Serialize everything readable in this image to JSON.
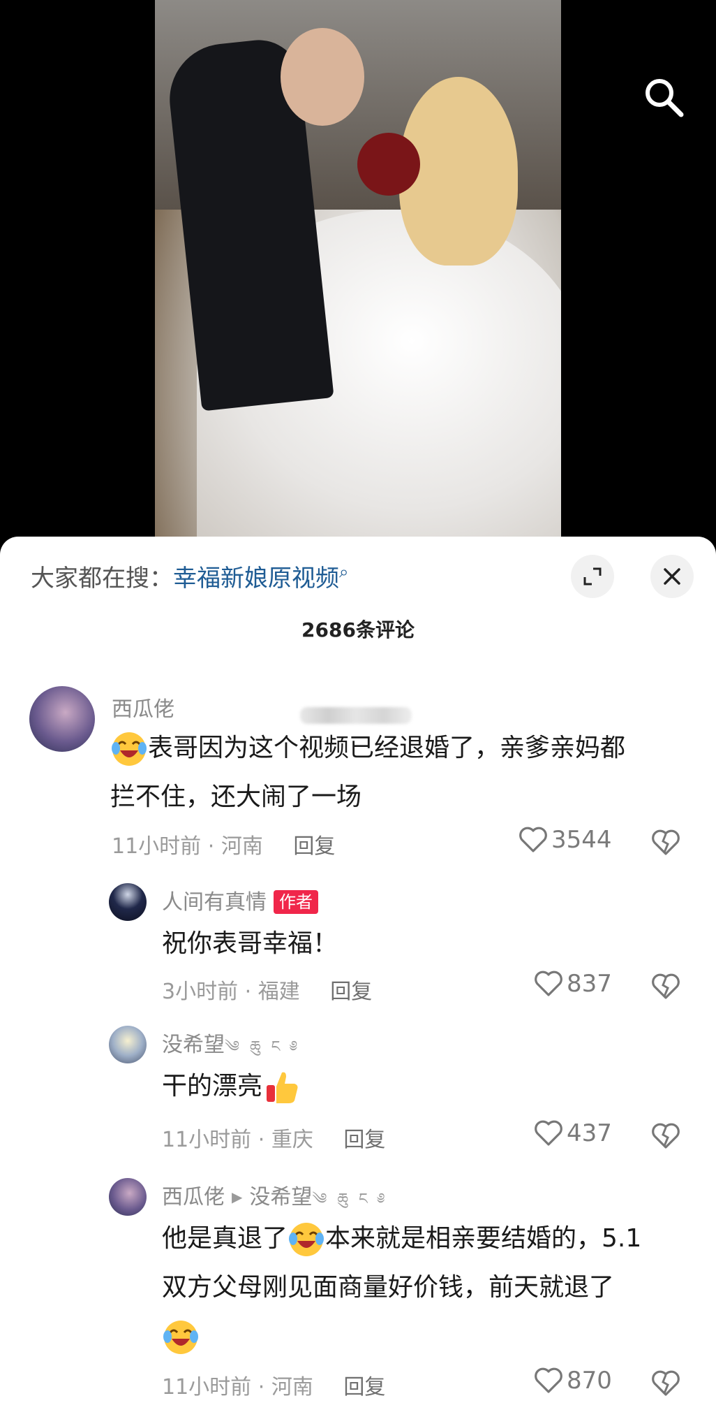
{
  "sheet": {
    "search_prefix": "大家都在搜：",
    "search_keyword": "幸福新娘原视频",
    "comment_count": "2686条评论"
  },
  "comments": [
    {
      "username": "西瓜佬",
      "text_line1": "表哥因为这个视频已经退婚了，亲爹亲妈都",
      "text_line2": "拦不住，还大闹了一场",
      "time": "11小时前",
      "location": "河南",
      "reply": "回复",
      "likes": "3544"
    },
    {
      "username": "人间有真情",
      "badge": "作者",
      "text": "祝你表哥幸福！",
      "time": "3小时前",
      "location": "福建",
      "reply": "回复",
      "likes": "837"
    },
    {
      "username": "没希望",
      "username_suffix": "༄ ཆུ ང ༅",
      "text": "干的漂亮",
      "time": "11小时前",
      "location": "重庆",
      "reply": "回复",
      "likes": "437"
    },
    {
      "username": "西瓜佬",
      "reply_to": "没希望",
      "reply_to_suffix": "༄ ཆུ ང ༅",
      "text_part1": "他是真退了",
      "text_part2": "本来就是相亲要结婚的，5.1",
      "text_line2": "双方父母刚见面商量好价钱，前天就退了",
      "time": "11小时前",
      "location": "河南",
      "reply": "回复",
      "likes": "870"
    }
  ],
  "separator": "·",
  "icons": [
    "search-icon",
    "expand-icon",
    "close-icon",
    "heart-icon",
    "broken-heart-icon",
    "laughing-crying-emoji",
    "thumbs-up-emoji"
  ],
  "colors": {
    "keyword": "#1f5c94",
    "badge": "#f0264a",
    "meta": "#9a9a9a"
  }
}
